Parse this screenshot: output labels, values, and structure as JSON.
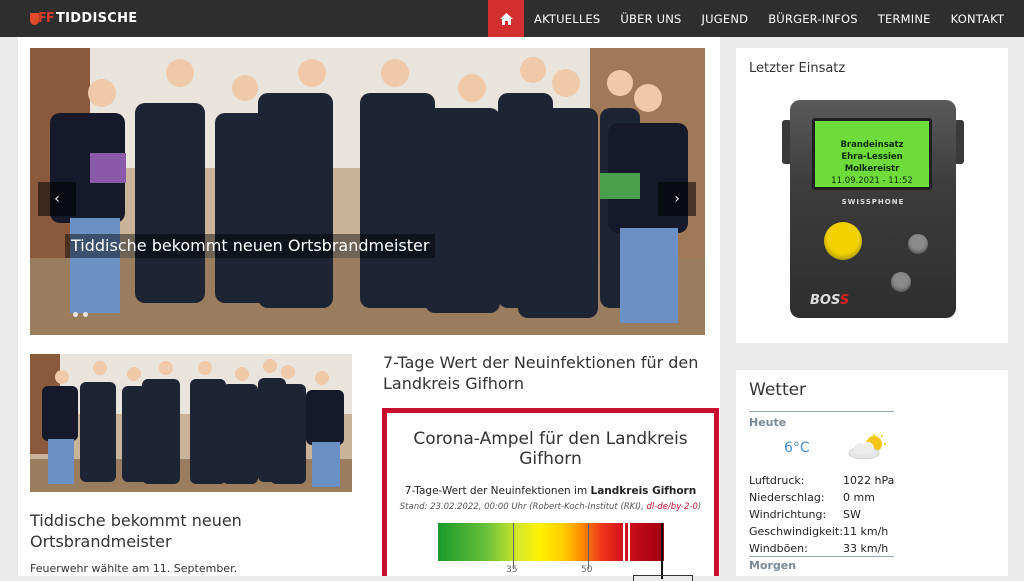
{
  "nav": {
    "logo_mark": "FF",
    "logo_text": "TIDDISCHE",
    "home_icon": "home-icon",
    "items": [
      "AKTUELLES",
      "ÜBER UNS",
      "JUGEND",
      "BÜRGER-INFOS",
      "TERMINE",
      "KONTAKT"
    ],
    "active_color": "#d32f2f"
  },
  "slider": {
    "caption": "Tiddische bekommt neuen Ortsbrandmeister",
    "prev_icon": "chevron-left-icon",
    "next_icon": "chevron-right-icon"
  },
  "news": {
    "title": "Tiddische bekommt neuen Ortsbrandmeister",
    "snippet": "Feuerwehr wählte am 11. September."
  },
  "corona": {
    "heading": "7-Tage Wert der Neuinfektionen für den Landkreis Gifhorn",
    "ampel_title": "Corona-Ampel für den Landkreis Gifhorn",
    "sub_prefix": "7-Tage-Wert der Neuinfektionen im ",
    "sub_bold": "Landkreis Gifhorn",
    "stand": "Stand: 23.02.2022, 00:00 Uhr (Robert-Koch-Institut (RKI), ",
    "license": "dl-de/by-2-0",
    "stand_end": ")",
    "tick_35": "35",
    "tick_50": "50",
    "accent": "#c8102e"
  },
  "einsatz": {
    "title": "Letzter Einsatz",
    "screen_line1": "Brandeinsatz",
    "screen_line2": "Ehra-Lessien Molkereistr",
    "screen_line3": "11.09.2021 - 11:52",
    "brand": "SWISSPHONE",
    "boss_a": "BOS",
    "boss_b": "S"
  },
  "wetter": {
    "title": "Wetter",
    "today_label": "Heute",
    "temp": "6°C",
    "icon": "partly-cloudy-icon",
    "rows": [
      {
        "k": "Luftdruck:",
        "v": "1022 hPa"
      },
      {
        "k": "Niederschlag:",
        "v": "0 mm"
      },
      {
        "k": "Windrichtung:",
        "v": "SW"
      },
      {
        "k": "Geschwindigkeit:",
        "v": "11 km/h"
      },
      {
        "k": "Windböen:",
        "v": "33 km/h"
      }
    ],
    "tomorrow_label": "Morgen"
  }
}
